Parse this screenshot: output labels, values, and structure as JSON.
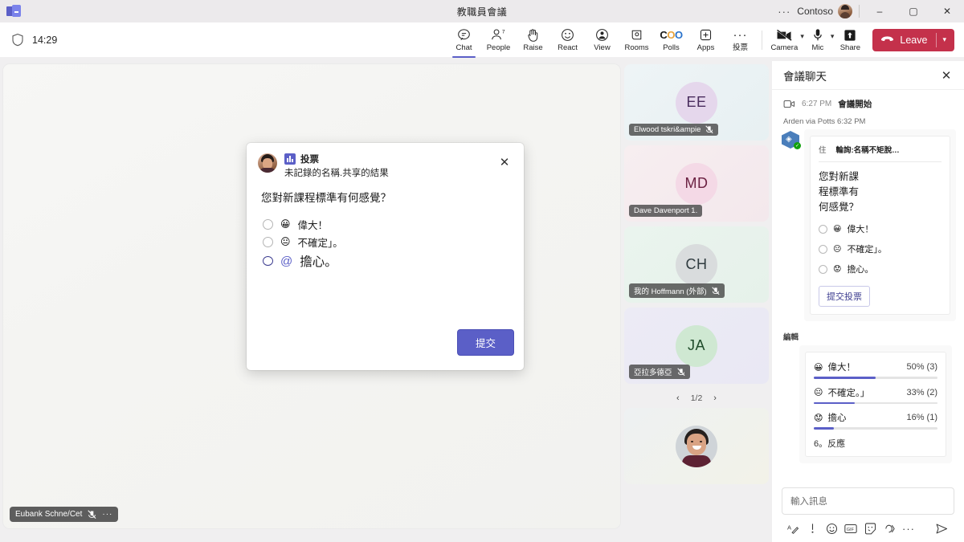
{
  "titlebar": {
    "app_logo": "teams-logo",
    "title": "教職員會議",
    "overflow": "···",
    "org": "Contoso",
    "minimize": "–",
    "maximize": "▢",
    "close": "✕"
  },
  "toolbar": {
    "shield_icon": "shield-icon",
    "clock": "14:29",
    "items": [
      {
        "label": "Chat",
        "icon": "chat-icon",
        "badge": "",
        "active": true
      },
      {
        "label": "People",
        "icon": "people-icon",
        "badge": "7",
        "active": false
      },
      {
        "label": "Raise",
        "icon": "raise-hand-icon",
        "badge": "",
        "active": false
      },
      {
        "label": "React",
        "icon": "react-smiley-icon",
        "badge": "",
        "active": false
      },
      {
        "label": "View",
        "icon": "view-icon",
        "badge": "",
        "active": false
      },
      {
        "label": "Rooms",
        "icon": "breakout-rooms-icon",
        "badge": "",
        "active": false
      },
      {
        "label": "Polls",
        "icon": "polls-coo-icon",
        "badge": "",
        "active": false
      },
      {
        "label": "Apps",
        "icon": "apps-plus-icon",
        "badge": "",
        "active": false
      },
      {
        "label": "投票",
        "icon": "more-ellipsis-icon",
        "badge": "",
        "active": false
      }
    ],
    "polls_glyph": "COO",
    "camera": {
      "label": "Camera",
      "icon": "camera-off-icon"
    },
    "mic": {
      "label": "Mic",
      "icon": "microphone-icon"
    },
    "share": {
      "label": "Share",
      "icon": "share-screen-icon"
    },
    "leave": {
      "label": "Leave",
      "icon": "hangup-icon"
    }
  },
  "stage": {
    "self_label": "Eubank Schne/Cet",
    "self_mic_icon": "mic-muted-icon",
    "self_more_icon": "more-ellipsis-icon"
  },
  "filmstrip": {
    "tiles": [
      {
        "initials": "EE",
        "name": "Elwood tskri&ampie",
        "muted": true,
        "avatar_color": "#e5d7ec",
        "text_color": "#4a2d5e",
        "bg": "linear-gradient(140deg,#eef4f6,#e7f0f2)"
      },
      {
        "initials": "MD",
        "name": "Dave Davenport 1.",
        "muted": false,
        "avatar_color": "#f4d9e6",
        "text_color": "#6b2142",
        "bg": "linear-gradient(140deg,#f7eef0,#f3e8ec)"
      },
      {
        "initials": "CH",
        "name": "我的 Hoffmann (外部)",
        "muted": true,
        "avatar_color": "#d9dcdd",
        "text_color": "#2f3b3f",
        "bg": "linear-gradient(140deg,#eaf4ee,#e6f1ea)"
      },
      {
        "initials": "JA",
        "name": "亞拉多德亞",
        "muted": true,
        "avatar_color": "#cfe8d2",
        "text_color": "#1f4b2a",
        "bg": "linear-gradient(140deg,#ecebf5,#e9e8f4)"
      }
    ],
    "pager": {
      "prev": "‹",
      "value": "1/2",
      "next": "›"
    },
    "bottom_tile": {
      "name": "",
      "avatar": "photo-avatar"
    }
  },
  "poll_dialog": {
    "app_name": "投票",
    "subtitle": "未記錄的名稱.共享的結果",
    "close_icon": "close-icon",
    "question": "您對新課程標準有何感覺？",
    "options": [
      {
        "emoji": "😀",
        "text": "偉大！"
      },
      {
        "emoji": "😐",
        "text": "不確定」。"
      },
      {
        "emoji": "@",
        "text": "擔心。"
      }
    ],
    "submit_label": "提交"
  },
  "chat": {
    "title": "會議聊天",
    "close_icon": "close-icon",
    "system": {
      "icon": "meeting-video-icon",
      "time": "6:27 PM",
      "text": "會議開始"
    },
    "sender": "Arden via Potts 6:32 PM",
    "poll_card": {
      "header_left": "住",
      "header_right": "輪詢:名稱不矩脫…",
      "question": "您對新課程標準有何感覺？",
      "options": [
        {
          "emoji": "😀",
          "text": "偉大！"
        },
        {
          "emoji": "😐",
          "text": "不確定」。"
        },
        {
          "emoji": "😟",
          "text": "擔心。"
        }
      ],
      "submit_label": "提交投票"
    },
    "edit_label": "編輯",
    "results_card": {
      "rows": [
        {
          "emoji": "😀",
          "text": "偉大！",
          "pct_label": "50% (3)",
          "pct": 50
        },
        {
          "emoji": "😐",
          "text": "不確定。」",
          "pct_label": "33% (2)",
          "pct": 33
        },
        {
          "emoji": "😟",
          "text": "擔心",
          "pct_label": "16% (1)",
          "pct": 16
        }
      ],
      "reactions": "6。反應"
    },
    "compose": {
      "placeholder": "輸入訊息",
      "tools": [
        "format-icon",
        "priority-icon",
        "emoji-icon",
        "gif-icon",
        "sticker-icon",
        "loop-icon",
        "more-ellipsis-icon"
      ],
      "send_icon": "send-icon"
    }
  },
  "colors": {
    "accent": "#5b5fc7",
    "leave": "#c4314b",
    "titlebar": "#eceaec",
    "stage": "#f5f5f3"
  }
}
